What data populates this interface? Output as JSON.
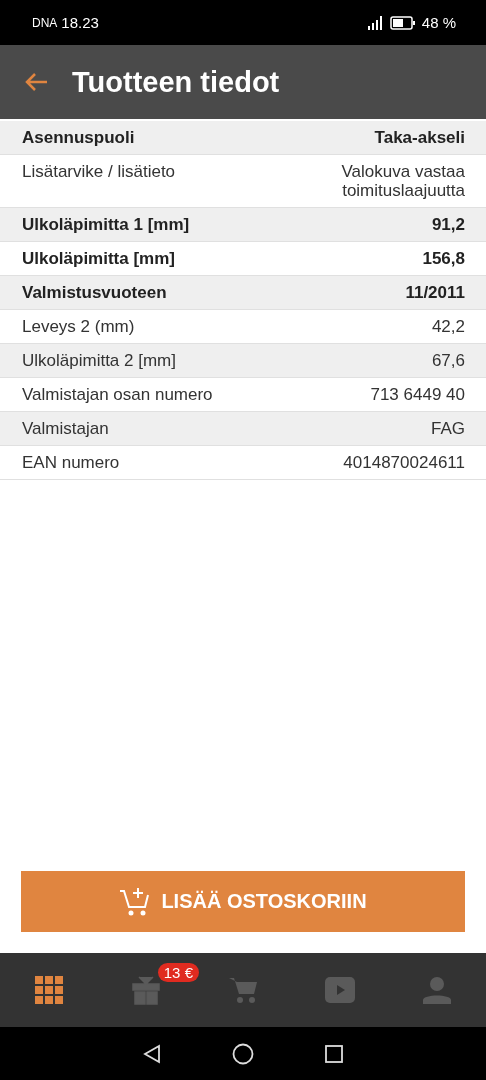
{
  "status_bar": {
    "carrier": "DNA",
    "time": "18.23",
    "battery": "48 %"
  },
  "app_bar": {
    "title": "Tuotteen tiedot"
  },
  "details": [
    {
      "label": "Asennuspuoli",
      "value": "Taka-akseli",
      "bold": true
    },
    {
      "label": "Lisätarvike / lisätieto",
      "value": "Valokuva vastaa toimituslaajuutta",
      "bold": false
    },
    {
      "label": "Ulkoläpimitta 1 [mm]",
      "value": "91,2",
      "bold": true
    },
    {
      "label": "Ulkoläpimitta [mm]",
      "value": "156,8",
      "bold": true
    },
    {
      "label": "Valmistusvuoteen",
      "value": "11/2011",
      "bold": true
    },
    {
      "label": "Leveys 2 (mm)",
      "value": "42,2",
      "bold": false
    },
    {
      "label": "Ulkoläpimitta 2 [mm]",
      "value": "67,6",
      "bold": false
    },
    {
      "label": "Valmistajan osan numero",
      "value": "713 6449 40",
      "bold": false
    },
    {
      "label": "Valmistajan",
      "value": "FAG",
      "bold": false
    },
    {
      "label": "EAN numero",
      "value": "4014870024611",
      "bold": false
    }
  ],
  "add_button": {
    "label": "LISÄÄ OSTOSKORIIN"
  },
  "bottom_nav": [
    {
      "kind": "grid",
      "selected": true
    },
    {
      "kind": "gift",
      "selected": false,
      "badge": "13 €"
    },
    {
      "kind": "cart",
      "selected": false
    },
    {
      "kind": "video",
      "selected": false
    },
    {
      "kind": "person",
      "selected": false
    }
  ]
}
